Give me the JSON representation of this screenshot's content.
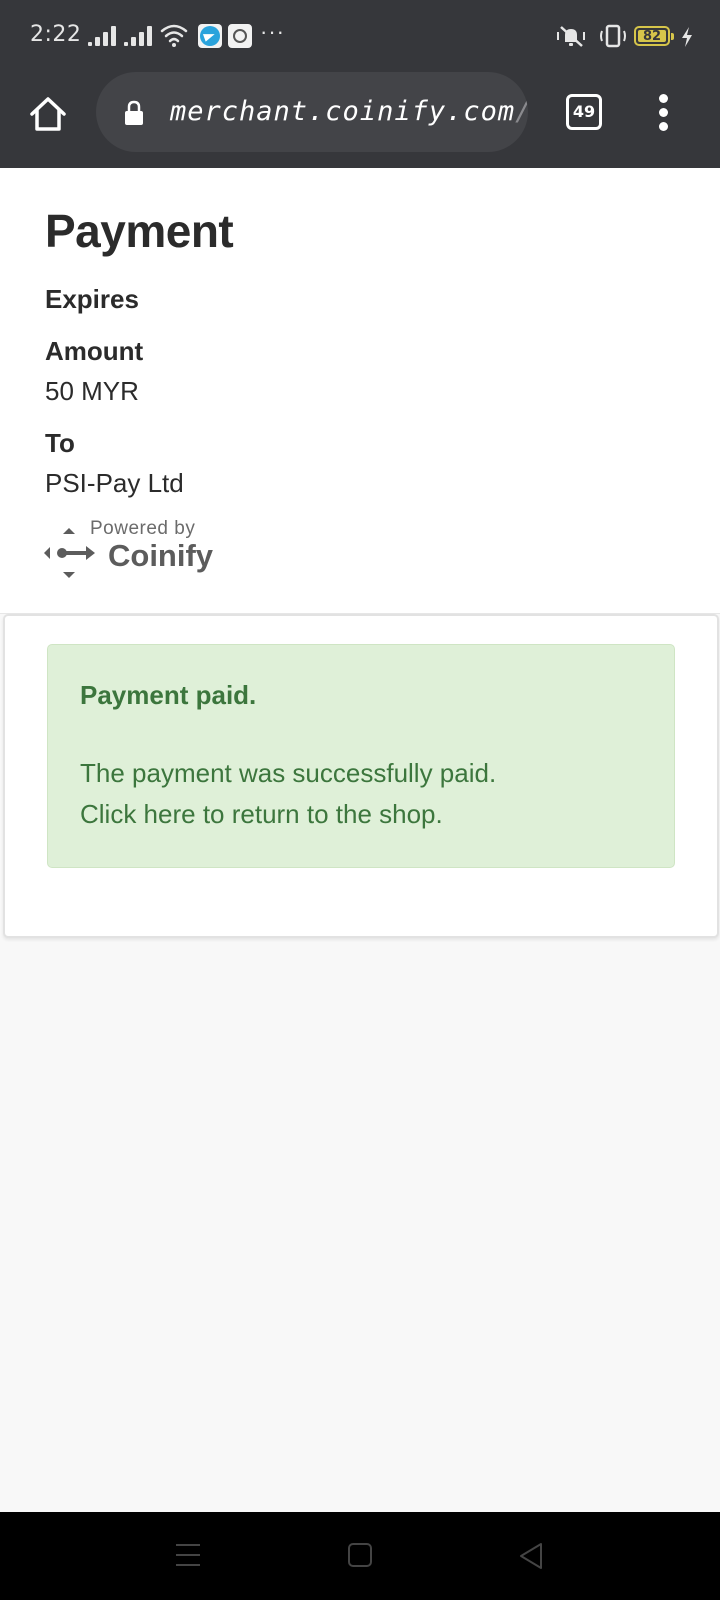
{
  "status_bar": {
    "time": "2:22",
    "battery_level": "82",
    "icons": [
      "signal-icon",
      "wifi-icon",
      "telegram-icon",
      "app-icon",
      "more-notifications-icon",
      "vibrate-mute-icon",
      "vibrate-icon",
      "battery-icon",
      "charging-icon"
    ]
  },
  "browser": {
    "url_host": "merchant.coinify.com",
    "url_tail": "/p",
    "tab_count": "49"
  },
  "payment": {
    "title": "Payment",
    "expires_label": "Expires",
    "amount_label": "Amount",
    "amount_value": "50 MYR",
    "to_label": "To",
    "to_value": "PSI-Pay Ltd",
    "powered_by": "Powered by",
    "brand": "Coinify"
  },
  "alert": {
    "title": "Payment paid.",
    "message": "The payment was successfully paid.",
    "link_text": "Click here to return to the shop."
  },
  "colors": {
    "toolbar_bg": "#36373b",
    "alert_bg": "#dff0d8",
    "alert_text": "#3c763d"
  }
}
